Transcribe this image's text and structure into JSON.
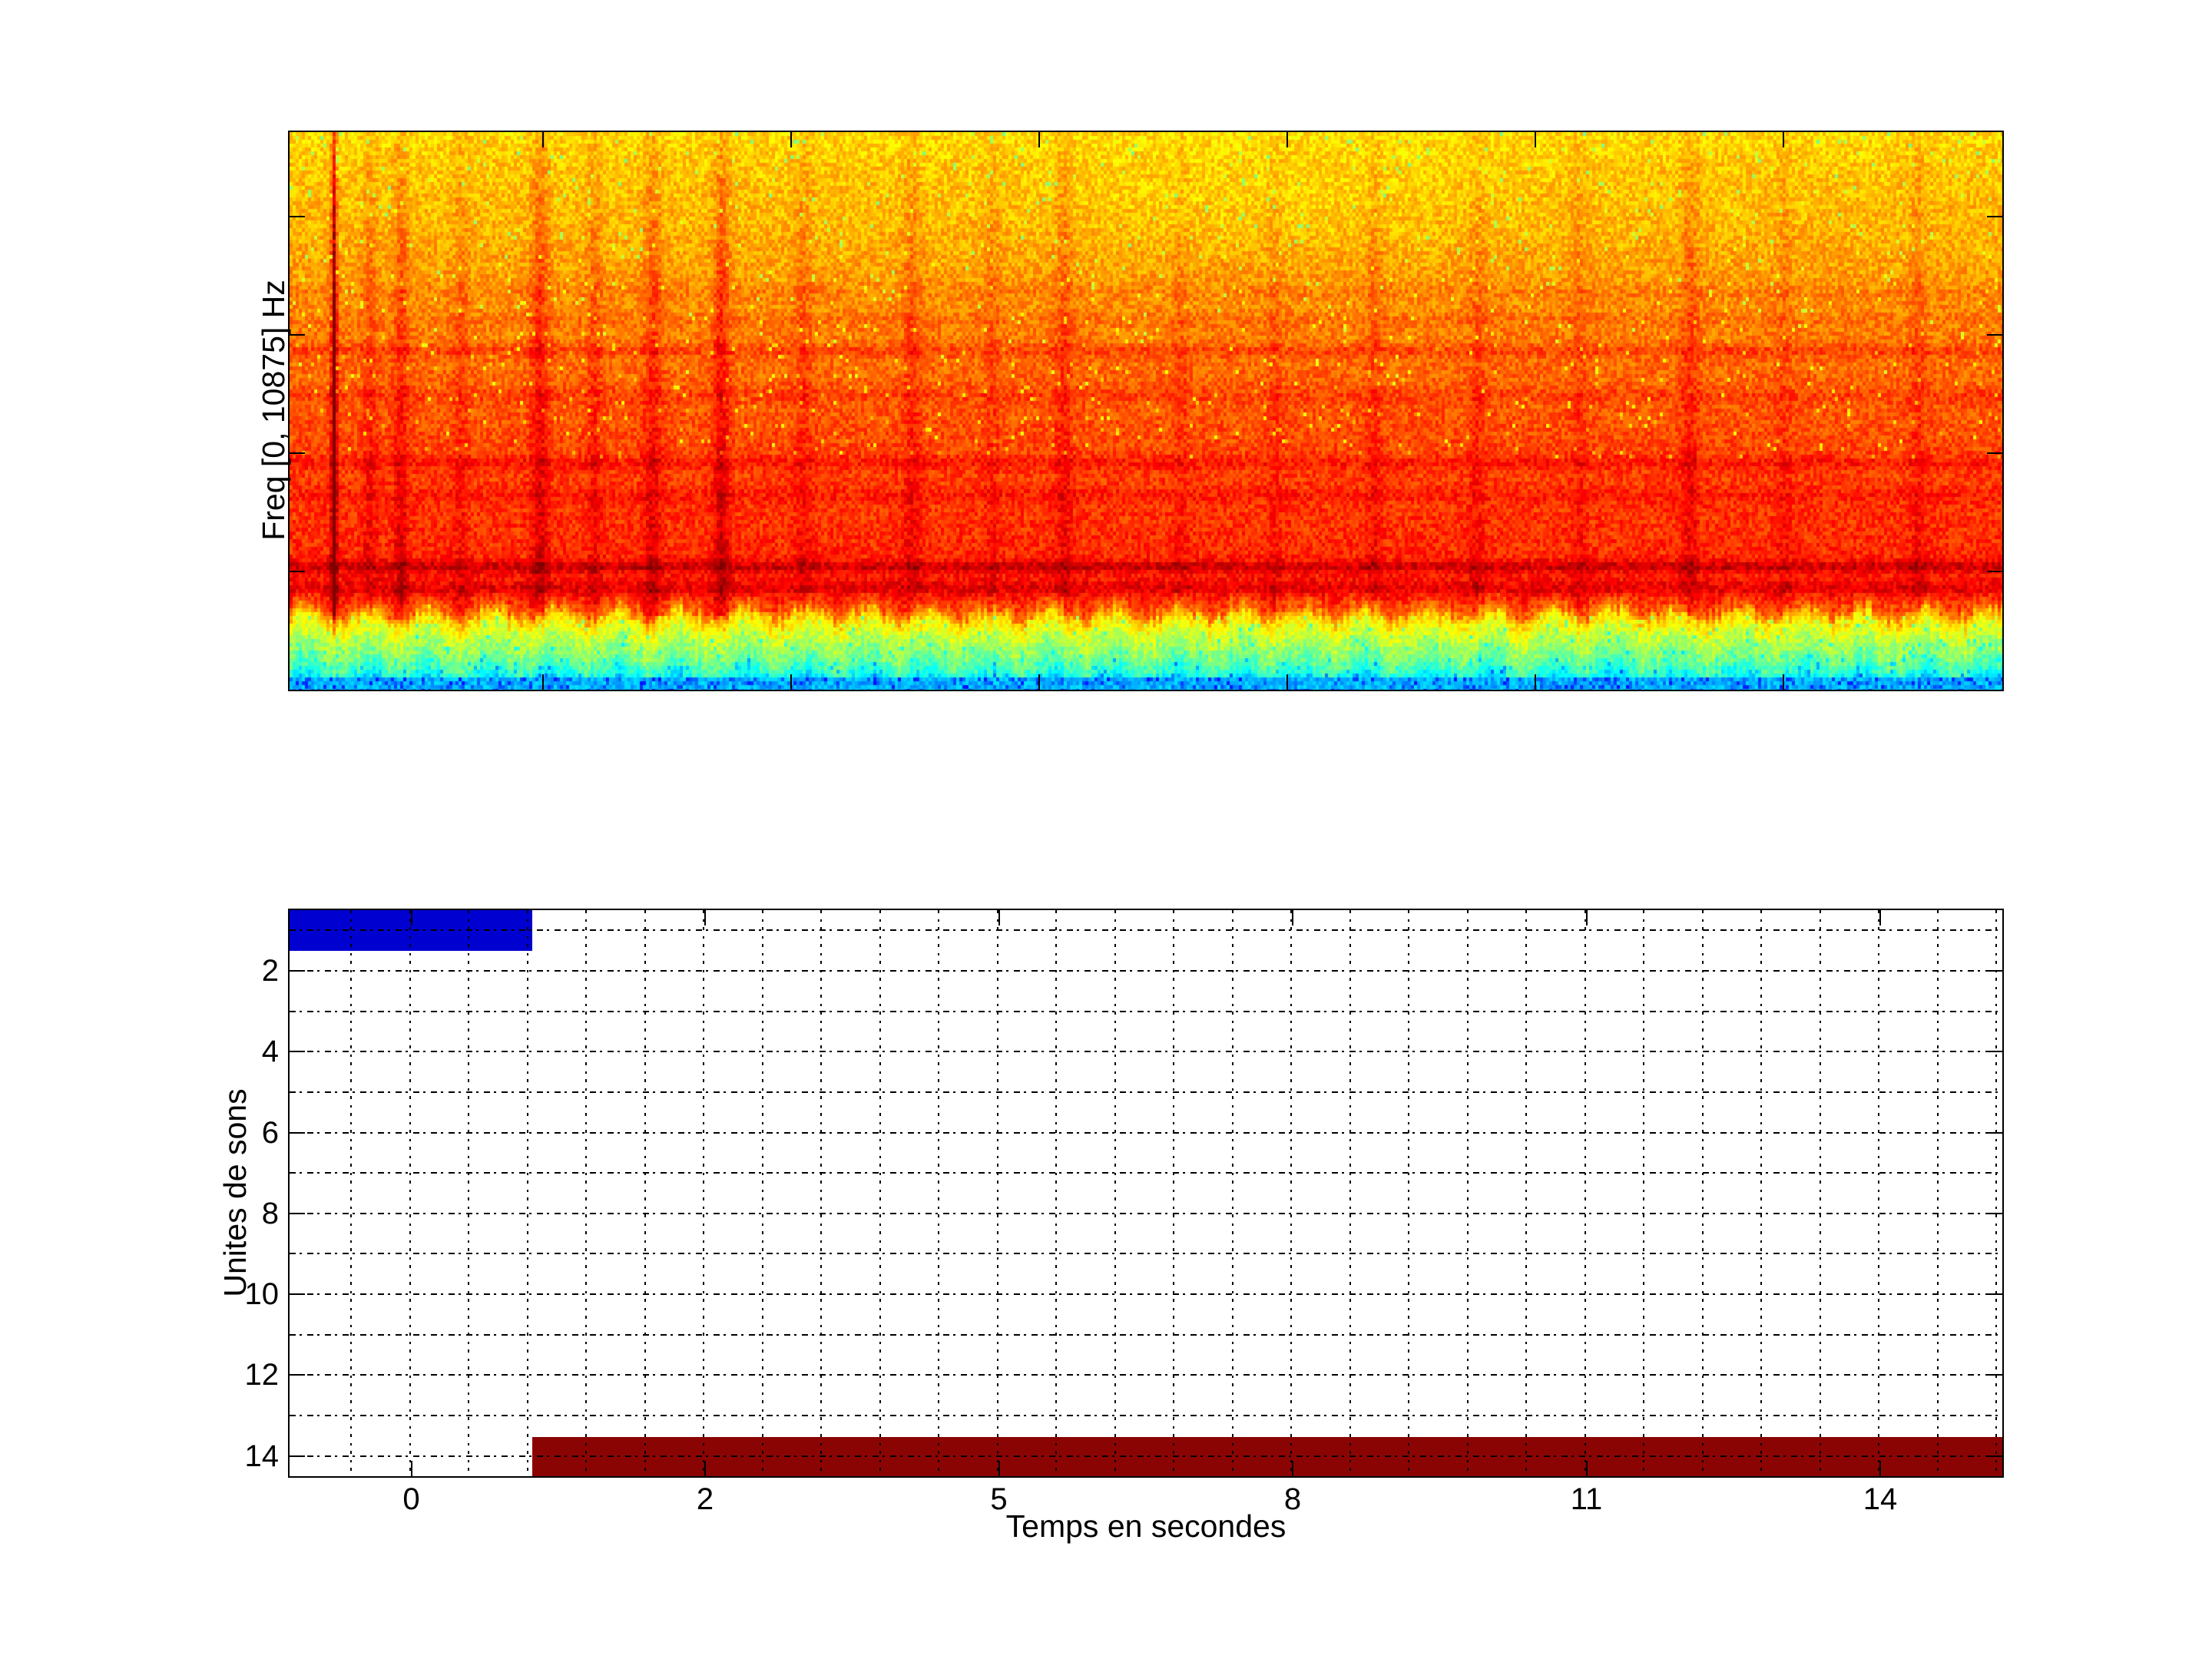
{
  "figure": {
    "background": "#ffffff",
    "text_color": "#000000",
    "border_color": "#000000"
  },
  "top_plot": {
    "name": "spectrogram",
    "ylabel": "Freq [0, 10875] Hz",
    "colormap": "jet",
    "x_tick_labels": [],
    "y_tick_labels": []
  },
  "bottom_plot": {
    "name": "sound-unit-activations",
    "xlabel": "Temps en secondes",
    "ylabel": "Unites de sons",
    "x_tick_labels": [
      "0",
      "2",
      "5",
      "8",
      "11",
      "14"
    ],
    "y_tick_labels": [
      "2",
      "4",
      "6",
      "8",
      "10",
      "12",
      "14"
    ],
    "grid_color": "#000000",
    "blue_bar_color": "#0000D0",
    "red_bar_color": "#8B0404"
  },
  "chart_data": [
    {
      "type": "heatmap",
      "subplot": "top",
      "title": "",
      "ylabel": "Freq [0, 10875] Hz",
      "freq_range_hz": [
        0,
        10875
      ],
      "colormap": "jet",
      "grid": false,
      "unlabeled_y_ticks": 4,
      "unlabeled_x_ticks": 6,
      "description": "Broadband noise spectrogram: yellow (moderate energy) at high frequencies, orange-red (high energy) at low-mid frequencies, dark red horizontal harmonic bands, thin dark vertical transient streaks, and a yellow-green-cyan low-energy band at the lowest frequencies (bottom edge).",
      "energy_profile_from_top": [
        [
          0,
          0.66
        ],
        [
          0.06,
          0.68
        ],
        [
          0.18,
          0.7
        ],
        [
          0.32,
          0.74
        ],
        [
          0.45,
          0.78
        ],
        [
          0.58,
          0.81
        ],
        [
          0.72,
          0.83
        ],
        [
          0.82,
          0.85
        ],
        [
          0.852,
          0.78
        ],
        [
          0.868,
          0.66
        ],
        [
          0.9,
          0.57
        ],
        [
          0.935,
          0.5
        ],
        [
          0.962,
          0.42
        ],
        [
          0.985,
          0.33
        ],
        [
          1,
          0.3
        ]
      ],
      "dark_bands_fraction_from_top": [
        {
          "pos": 0.285,
          "amp": 0.02,
          "w": 0.012
        },
        {
          "pos": 0.335,
          "amp": 0.02,
          "w": 0.012
        },
        {
          "pos": 0.39,
          "amp": 0.05,
          "w": 0.011
        },
        {
          "pos": 0.47,
          "amp": 0.03,
          "w": 0.013
        },
        {
          "pos": 0.59,
          "amp": 0.045,
          "w": 0.011
        },
        {
          "pos": 0.648,
          "amp": 0.03,
          "w": 0.013
        },
        {
          "pos": 0.775,
          "amp": 0.085,
          "w": 0.01
        },
        {
          "pos": 0.813,
          "amp": 0.05,
          "w": 0.013
        }
      ],
      "vertical_streaks_time_fraction": [
        {
          "pos": 0.026,
          "amp": 0.26,
          "w": 0.0016
        },
        {
          "pos": 0.047,
          "amp": 0.05,
          "w": 0.004
        },
        {
          "pos": 0.065,
          "amp": 0.07,
          "w": 0.004
        },
        {
          "pos": 0.1,
          "amp": 0.04,
          "w": 0.004
        },
        {
          "pos": 0.146,
          "amp": 0.08,
          "w": 0.005
        },
        {
          "pos": 0.178,
          "amp": 0.05,
          "w": 0.004
        },
        {
          "pos": 0.212,
          "amp": 0.07,
          "w": 0.005
        },
        {
          "pos": 0.252,
          "amp": 0.09,
          "w": 0.0045
        },
        {
          "pos": 0.3,
          "amp": 0.04,
          "w": 0.005
        },
        {
          "pos": 0.363,
          "amp": 0.05,
          "w": 0.005
        },
        {
          "pos": 0.41,
          "amp": 0.035,
          "w": 0.004
        },
        {
          "pos": 0.452,
          "amp": 0.055,
          "w": 0.005
        },
        {
          "pos": 0.52,
          "amp": 0.03,
          "w": 0.004
        },
        {
          "pos": 0.575,
          "amp": 0.03,
          "w": 0.004
        },
        {
          "pos": 0.633,
          "amp": 0.04,
          "w": 0.0045
        },
        {
          "pos": 0.693,
          "amp": 0.04,
          "w": 0.0045
        },
        {
          "pos": 0.752,
          "amp": 0.035,
          "w": 0.004
        },
        {
          "pos": 0.817,
          "amp": 0.055,
          "w": 0.005
        },
        {
          "pos": 0.872,
          "amp": 0.03,
          "w": 0.004
        },
        {
          "pos": 0.95,
          "amp": 0.04,
          "w": 0.0045
        }
      ]
    },
    {
      "type": "heatmap",
      "subplot": "bottom",
      "xlabel": "Temps en secondes",
      "ylabel": "Unites de sons",
      "x_tick_values": [
        0,
        2,
        5,
        8,
        11,
        14
      ],
      "y_tick_values": [
        2,
        4,
        6,
        8,
        10,
        12,
        14
      ],
      "y_range": [
        0.5,
        14.5
      ],
      "units_count": 14,
      "grid": true,
      "grid_style": "dotted",
      "active_segments": [
        {
          "unit": 1,
          "color": "#0000D0",
          "x_fraction_from": 0.0,
          "x_fraction_to": 0.1417,
          "note": "blue bar: from plot left edge to ~0.85 s (just before the 1 s mark between ticks 0 and 2)"
        },
        {
          "unit": 14,
          "color": "#8B0404",
          "x_fraction_from": 0.1417,
          "x_fraction_to": 1.0,
          "note": "dark red bar: from ~0.85 s to the plot right edge (~15.6 s)"
        }
      ]
    }
  ]
}
